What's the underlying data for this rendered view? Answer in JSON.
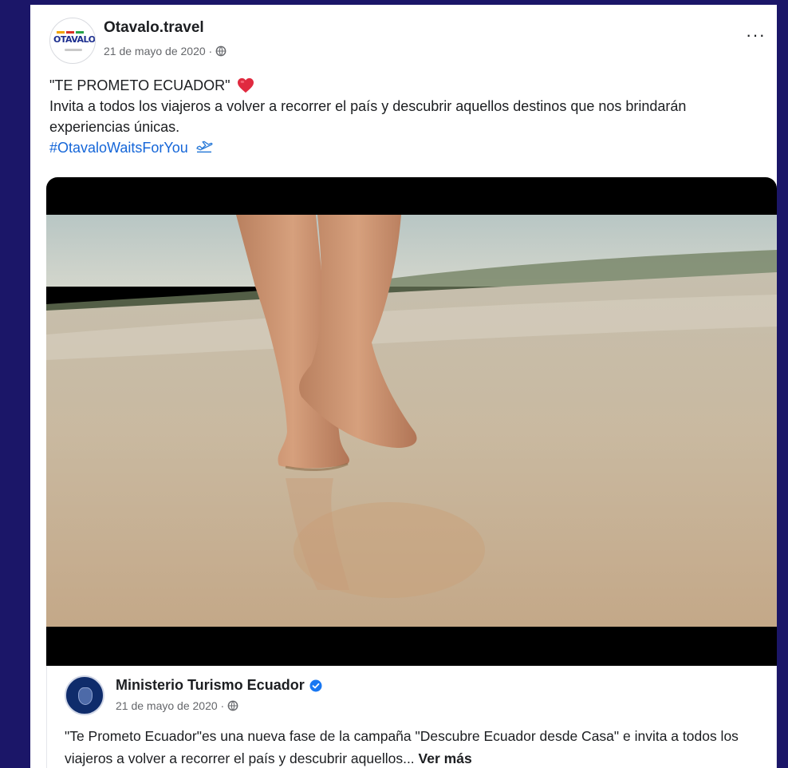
{
  "post": {
    "author": "Otavalo.travel",
    "avatar_text": "OTAVALO",
    "date": "21 de mayo de 2020 ·",
    "more_label": "···",
    "title": "\"TE PROMETO ECUADOR\"",
    "body": "Invita a todos los viajeros a volver a recorrer el país y descubrir aquellos destinos que nos brindarán experiencias únicas.",
    "hashtag": "#OtavaloWaitsForYou"
  },
  "shared": {
    "author": "Ministerio Turismo Ecuador",
    "date": "21 de mayo de 2020 ·",
    "text": "\"Te Prometo Ecuador\"es una nueva fase de la campaña \"Descubre Ecuador desde Casa\" e invita a todos los viajeros a volver a recorrer el país y descubrir aquellos...",
    "see_more": "Ver más"
  },
  "icons": {
    "audience": "globe-icon",
    "emoji_heart": "red-heart-icon",
    "emoji_plane": "airplane-departure-icon",
    "verified": "verified-badge-icon"
  },
  "colors": {
    "page_background": "#1b1668",
    "link": "#1566d8",
    "verified": "#1877f2",
    "heart": "#e02a3f"
  }
}
